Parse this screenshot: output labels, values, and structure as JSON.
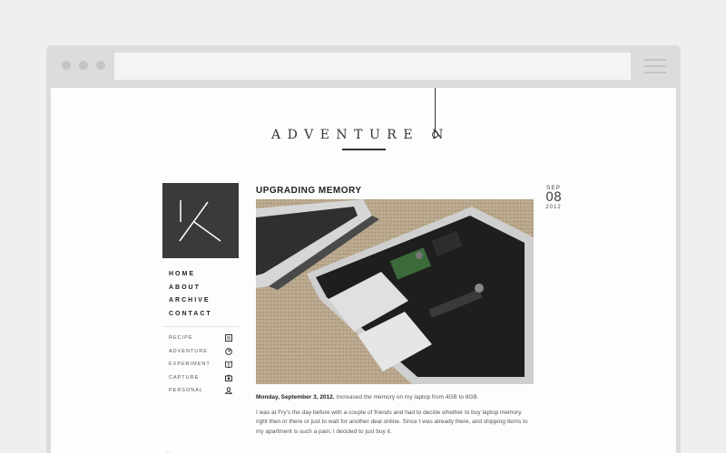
{
  "site": {
    "title_part1": "ADVENTURE",
    "title_part2": "N"
  },
  "nav": [
    {
      "label": "HOME"
    },
    {
      "label": "ABOUT"
    },
    {
      "label": "ARCHIVE"
    },
    {
      "label": "CONTACT"
    }
  ],
  "categories": [
    {
      "label": "RECIPE",
      "icon": "recipe-icon"
    },
    {
      "label": "ADVENTURE",
      "icon": "compass-icon"
    },
    {
      "label": "EXPERIMENT",
      "icon": "book-icon"
    },
    {
      "label": "CAPTURE",
      "icon": "camera-icon"
    },
    {
      "label": "PERSONAL",
      "icon": "person-icon"
    }
  ],
  "search": {
    "placeholder": ""
  },
  "post": {
    "title": "UPGRADING MEMORY",
    "date_month": "SEP",
    "date_day": "08",
    "date_year": "2012",
    "lead_date": "Monday, September 3, 2012.",
    "lead_rest": " Increased the memory on my laptop from 4GB to 8GB.",
    "paragraph2": "I was at Fry's the day before with a couple of friends and had to decide whether to buy laptop memory right then or there or just to wait for another deal online. Since I was already there, and shipping items to my apartment is such a pain, I decided to just buy it."
  },
  "colors": {
    "page_bg": "#efefef",
    "browser_chrome": "#dcdcdc",
    "logo_bg": "#3a3a3a",
    "text_dark": "#222222"
  }
}
